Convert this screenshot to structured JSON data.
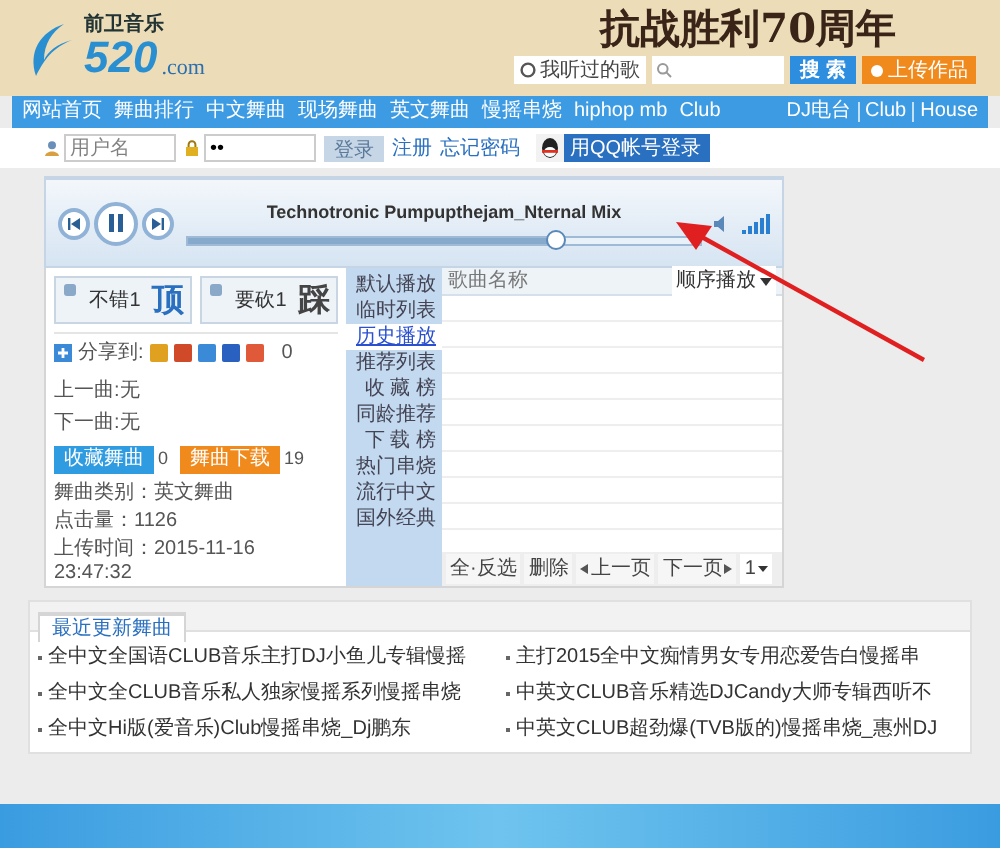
{
  "header": {
    "logo": {
      "name": "前卫音乐",
      "number": "520",
      "domain": ".com"
    },
    "banner_title": "抗战胜利70周年",
    "history_button": "我听过的歌",
    "search_button": "搜 索",
    "upload_button": "上传作品"
  },
  "nav": {
    "items": [
      "网站首页",
      "舞曲排行",
      "中文舞曲",
      "现场舞曲",
      "英文舞曲",
      "慢摇串烧",
      "hiphop mb",
      "Club"
    ],
    "right": [
      "DJ电台",
      "Club",
      "House"
    ]
  },
  "login": {
    "username_placeholder": "用户名",
    "password_value": "••",
    "login_button": "登录",
    "links": [
      "注册",
      "忘记密码"
    ],
    "qq_button": "用QQ帐号登录"
  },
  "player": {
    "title": "Technotronic Pumpupthejam_Nternal Mix",
    "level": 0.72
  },
  "votes": [
    {
      "kind": "up",
      "glyph": "顶",
      "label": "不错1"
    },
    {
      "kind": "down",
      "glyph": "踩",
      "label": "要砍1"
    }
  ],
  "share": {
    "label": "分享到:",
    "count": "0"
  },
  "prev": "上一曲:无",
  "next": "下一曲:无",
  "actions": [
    {
      "label": "收藏舞曲",
      "count": "0",
      "color": "#2f9be0"
    },
    {
      "label": "舞曲下载",
      "count": "19",
      "color": "#f08a1c"
    }
  ],
  "info": [
    "舞曲类别：英文舞曲",
    "点击量：1126",
    "上传时间：2015-11-16 23:47:32"
  ],
  "playlist_tabs": [
    {
      "label": "默认播放",
      "selected": false
    },
    {
      "label": "临时列表",
      "selected": false
    },
    {
      "label": "历史播放",
      "selected": true
    },
    {
      "label": "推荐列表",
      "selected": false
    },
    {
      "label": "收 藏 榜",
      "selected": false
    },
    {
      "label": "同龄推荐",
      "selected": false
    },
    {
      "label": "下 载 榜",
      "selected": false
    },
    {
      "label": "热门串烧",
      "selected": false
    },
    {
      "label": "流行中文",
      "selected": false
    },
    {
      "label": "国外经典",
      "selected": false
    }
  ],
  "list": {
    "column": "歌曲名称",
    "mode": "顺序播放",
    "select_all": "全·反选",
    "delete": "删除",
    "prev_page": "上一页",
    "next_page": "下一页",
    "page": "1"
  },
  "recent": {
    "tab": "最近更新舞曲",
    "items": [
      "全中文全国语CLUB音乐主打DJ小鱼儿专辑慢摇",
      "主打2015全中文痴情男女专用恋爱告白慢摇串",
      "全中文全CLUB音乐私人独家慢摇系列慢摇串烧",
      "中英文CLUB音乐精选DJCandy大师专辑西听不",
      "全中文Hi版(爱音乐)Club慢摇串烧_Dj鹏东",
      "中英文CLUB超劲爆(TVB版的)慢摇串烧_惠州DJ"
    ]
  }
}
